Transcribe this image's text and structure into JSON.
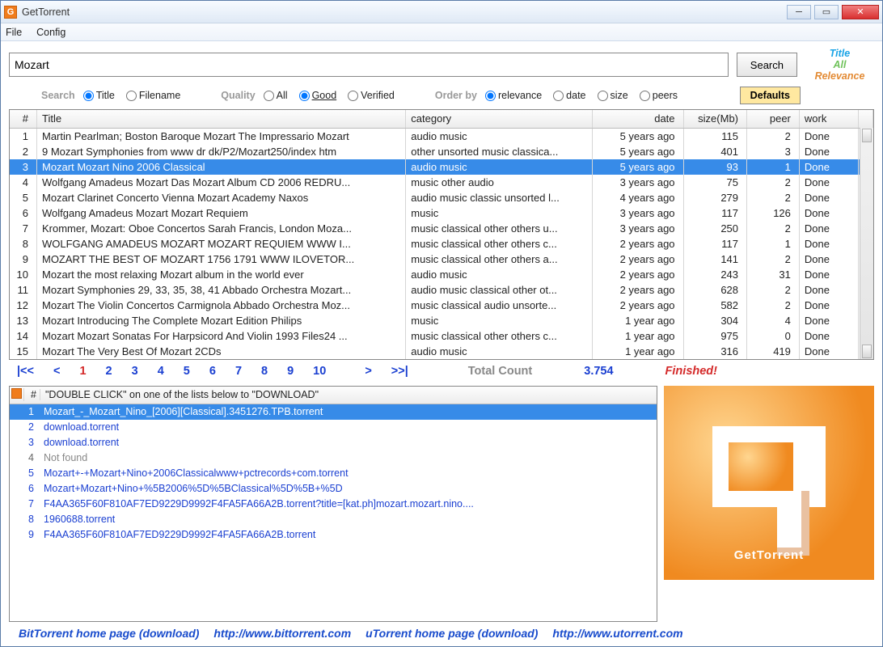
{
  "window": {
    "title": "GetTorrent"
  },
  "menu": {
    "file": "File",
    "config": "Config"
  },
  "search": {
    "value": "Mozart",
    "btn": "Search",
    "defaults": "Defaults",
    "lbl_search": "Search",
    "opt_title": "Title",
    "opt_filename": "Filename",
    "lbl_quality": "Quality",
    "opt_all": "All",
    "opt_good": "Good",
    "opt_verified": "Verified",
    "lbl_orderby": "Order by",
    "opt_relevance": "relevance",
    "opt_date": "date",
    "opt_size": "size",
    "opt_peers": "peers"
  },
  "status": {
    "l1": "Title",
    "l2": "All",
    "l3": "Relevance"
  },
  "cols": {
    "num": "#",
    "title": "Title",
    "category": "category",
    "date": "date",
    "size": "size(Mb)",
    "peer": "peer",
    "work": "work"
  },
  "rows": [
    {
      "n": "1",
      "title": "Martin Pearlman; Boston Baroque Mozart The Impressario Mozart",
      "cat": "audio music",
      "date": "5 years ago",
      "size": "115",
      "peer": "2",
      "work": "Done",
      "sel": false
    },
    {
      "n": "2",
      "title": "9 Mozart Symphonies from www dr dk/P2/Mozart250/index htm",
      "cat": "other unsorted music classica...",
      "date": "5 years ago",
      "size": "401",
      "peer": "3",
      "work": "Done",
      "sel": false
    },
    {
      "n": "3",
      "title": "Mozart Mozart Nino 2006 Classical",
      "cat": "audio music",
      "date": "5 years ago",
      "size": "93",
      "peer": "1",
      "work": "Done",
      "sel": true
    },
    {
      "n": "4",
      "title": "Wolfgang Amadeus Mozart Das Mozart Album CD 2006 REDRU...",
      "cat": "music other audio",
      "date": "3 years ago",
      "size": "75",
      "peer": "2",
      "work": "Done",
      "sel": false
    },
    {
      "n": "5",
      "title": "Mozart Clarinet Concerto Vienna Mozart Academy Naxos",
      "cat": "audio music classic unsorted l...",
      "date": "4 years ago",
      "size": "279",
      "peer": "2",
      "work": "Done",
      "sel": false
    },
    {
      "n": "6",
      "title": "Wolfgang Amadeus Mozart Mozart Requiem",
      "cat": "music",
      "date": "3 years ago",
      "size": "117",
      "peer": "126",
      "work": "Done",
      "sel": false
    },
    {
      "n": "7",
      "title": "Krommer, Mozart: Oboe Concertos Sarah Francis, London Moza...",
      "cat": "music classical other others u...",
      "date": "3 years ago",
      "size": "250",
      "peer": "2",
      "work": "Done",
      "sel": false
    },
    {
      "n": "8",
      "title": "WOLFGANG AMADEUS MOZART MOZART REQUIEM WWW I...",
      "cat": "music classical other others c...",
      "date": "2 years ago",
      "size": "117",
      "peer": "1",
      "work": "Done",
      "sel": false
    },
    {
      "n": "9",
      "title": "MOZART THE BEST OF MOZART 1756 1791 WWW ILOVETOR...",
      "cat": "music classical other others a...",
      "date": "2 years ago",
      "size": "141",
      "peer": "2",
      "work": "Done",
      "sel": false
    },
    {
      "n": "10",
      "title": "Mozart the most relaxing Mozart album in the world ever",
      "cat": "audio music",
      "date": "2 years ago",
      "size": "243",
      "peer": "31",
      "work": "Done",
      "sel": false
    },
    {
      "n": "11",
      "title": "Mozart Symphonies 29, 33, 35, 38, 41 Abbado Orchestra Mozart...",
      "cat": "audio music classical other ot...",
      "date": "2 years ago",
      "size": "628",
      "peer": "2",
      "work": "Done",
      "sel": false
    },
    {
      "n": "12",
      "title": "Mozart The Violin Concertos Carmignola Abbado Orchestra Moz...",
      "cat": "music classical audio unsorte...",
      "date": "2 years ago",
      "size": "582",
      "peer": "2",
      "work": "Done",
      "sel": false
    },
    {
      "n": "13",
      "title": "Mozart Introducing The Complete Mozart Edition Philips",
      "cat": "music",
      "date": "1 year ago",
      "size": "304",
      "peer": "4",
      "work": "Done",
      "sel": false
    },
    {
      "n": "14",
      "title": "Mozart Mozart Sonatas For Harpsicord And Violin 1993 Files24 ...",
      "cat": "music classical other others c...",
      "date": "1 year ago",
      "size": "975",
      "peer": "0",
      "work": "Done",
      "sel": false
    },
    {
      "n": "15",
      "title": "Mozart The Very Best Of Mozart 2CDs",
      "cat": "audio music",
      "date": "1 year ago",
      "size": "316",
      "peer": "419",
      "work": "Done",
      "sel": false
    }
  ],
  "pager": {
    "first": "|<<",
    "prev": "<",
    "next": ">",
    "last": ">>|",
    "pages": [
      "1",
      "2",
      "3",
      "4",
      "5",
      "6",
      "7",
      "8",
      "9",
      "10"
    ],
    "current": "1",
    "total_lbl": "Total Count",
    "total": "3.754",
    "finished": "Finished!"
  },
  "dl": {
    "head": "\"DOUBLE CLICK\" on one of the lists below to \"DOWNLOAD\"",
    "items": [
      {
        "n": "1",
        "t": "Mozart_-_Mozart_Nino_[2006][Classical].3451276.TPB.torrent",
        "sel": true
      },
      {
        "n": "2",
        "t": "download.torrent"
      },
      {
        "n": "3",
        "t": "download.torrent"
      },
      {
        "n": "4",
        "t": "Not found",
        "nf": true
      },
      {
        "n": "5",
        "t": "Mozart+-+Mozart+Nino+2006Classicalwww+pctrecords+com.torrent"
      },
      {
        "n": "6",
        "t": "Mozart+Mozart+Nino+%5B2006%5D%5BClassical%5D%5B+%5D"
      },
      {
        "n": "7",
        "t": "F4AA365F60F810AF7ED9229D9992F4FA5FA66A2B.torrent?title=[kat.ph]mozart.mozart.nino...."
      },
      {
        "n": "8",
        "t": "1960688.torrent"
      },
      {
        "n": "9",
        "t": "F4AA365F60F810AF7ED9229D9992F4FA5FA66A2B.torrent"
      }
    ]
  },
  "logoart": {
    "txt": "GetTorrent"
  },
  "footer": {
    "a": "BitTorrent home page (download)",
    "au": "http://www.bittorrent.com",
    "b": "uTorrent home page (download)",
    "bu": "http://www.utorrent.com"
  }
}
